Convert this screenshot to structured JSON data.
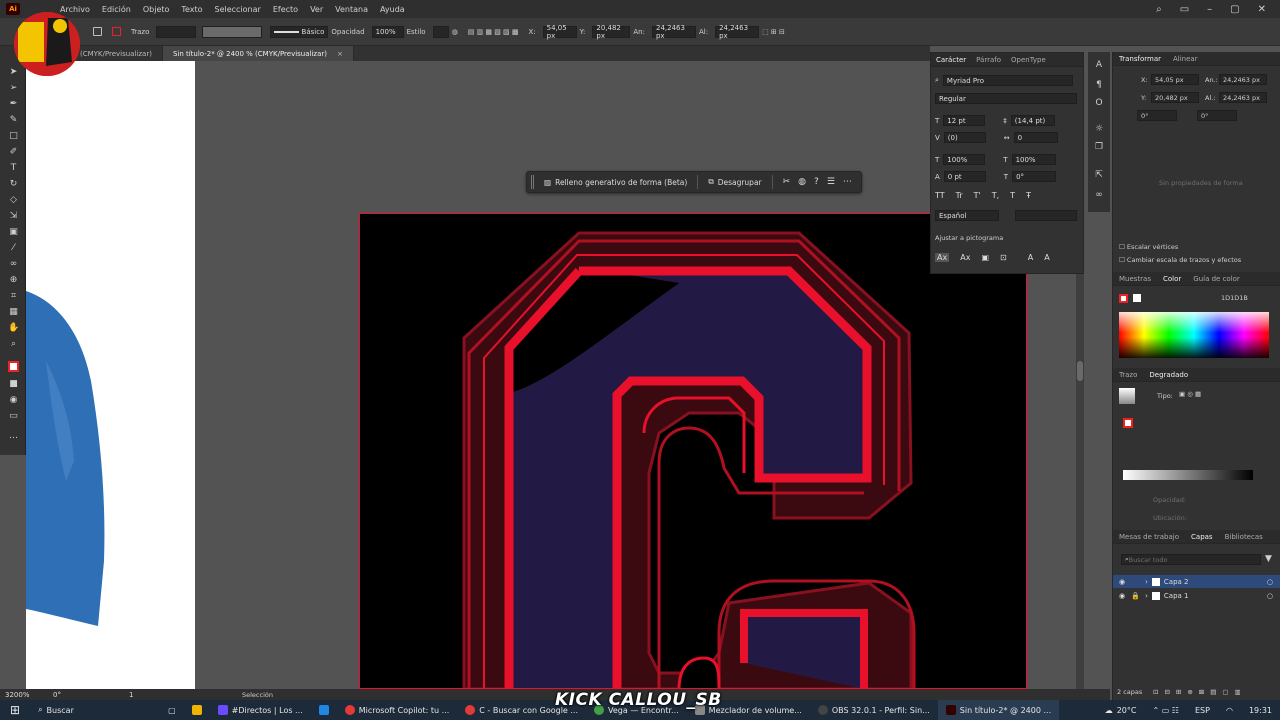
{
  "menubar": {
    "logo": "Ai",
    "items": [
      "Archivo",
      "Edición",
      "Objeto",
      "Texto",
      "Seleccionar",
      "Efecto",
      "Ver",
      "Ventana",
      "Ayuda"
    ]
  },
  "control": {
    "stroke_label": "Trazo",
    "stroke_profile": "Básico",
    "opacity_label": "Opacidad",
    "opacity_value": "100%",
    "style_label": "Estilo",
    "x_value": "54,05 px",
    "y_value": "20,482 px",
    "w_label": "An:",
    "w_value": "24,2463 px",
    "h_label": "Al:",
    "h_value": "24,2463 px"
  },
  "tabs": [
    {
      "label": "(CMYK/Previsualizar)"
    },
    {
      "label": "Sin título-2* @ 2400 % (CMYK/Previsualizar)",
      "close": "×"
    }
  ],
  "context_bar": {
    "gen_fill": "Relleno generativo de forma (Beta)",
    "ungroup": "Desagrupar"
  },
  "character_panel": {
    "tabs": [
      "Carácter",
      "Párrafo",
      "OpenType"
    ],
    "font": "Myriad Pro",
    "style": "Regular",
    "size": "12 pt",
    "leading": "(14,4 pt)",
    "kerning": "(0)",
    "tracking": "0",
    "vscale": "100%",
    "hscale": "100%",
    "baseline": "0 pt",
    "rotation": "0°",
    "language": "Español",
    "snap_label": "Ajustar a pictograma"
  },
  "transform_panel": {
    "tabs": [
      "Transformar",
      "Alinear"
    ],
    "x": "54,05 px",
    "y": "20,482 px",
    "w_label": "An.:",
    "w": "24,2463 px",
    "h_label": "Al.:",
    "h": "24,2463 px",
    "angle1": "0°",
    "angle2": "0°",
    "shape_placeholder": "Sin propiedades de forma",
    "scale_corners": "Escalar vértices",
    "scale_strokes": "Cambiar escala de trazos y efectos"
  },
  "color_panel": {
    "tabs": [
      "Muestras",
      "Color",
      "Guía de color"
    ],
    "hex": "1D1D1B"
  },
  "gradient_panel": {
    "tabs": [
      "Trazo",
      "Degradado"
    ],
    "type_label": "Tipo:",
    "opacity_label": "Opacidad:",
    "location_label": "Ubicación:"
  },
  "layers_panel": {
    "tabs": [
      "Mesas de trabajo",
      "Capas",
      "Bibliotecas"
    ],
    "search_placeholder": "Buscar todo",
    "layers": [
      "Capa 2",
      "Capa 1"
    ],
    "count": "2 capas"
  },
  "status": {
    "zoom": "3200%",
    "angle": "0°",
    "artboard": "1",
    "tool": "Selección"
  },
  "taskbar": {
    "search": "Buscar",
    "items": [
      "#Directos | Los ...",
      "Microsoft Copilot: tu ...",
      "C - Buscar con Google ...",
      "Vega — Encontr...",
      "Mezclador de volume...",
      "OBS 32.0.1 - Perfil: Sin...",
      "Sin título-2* @ 2400 ..."
    ],
    "weather": "20°C",
    "lang": "ESP",
    "time": "19:31"
  },
  "overlay": "KICK CALLOU_SB",
  "colors": {
    "artwork_red": "#e8102a",
    "artwork_purple": "#221a45",
    "artwork_darkred": "#5a0c14",
    "blue_shape": "#2f6fb5"
  }
}
